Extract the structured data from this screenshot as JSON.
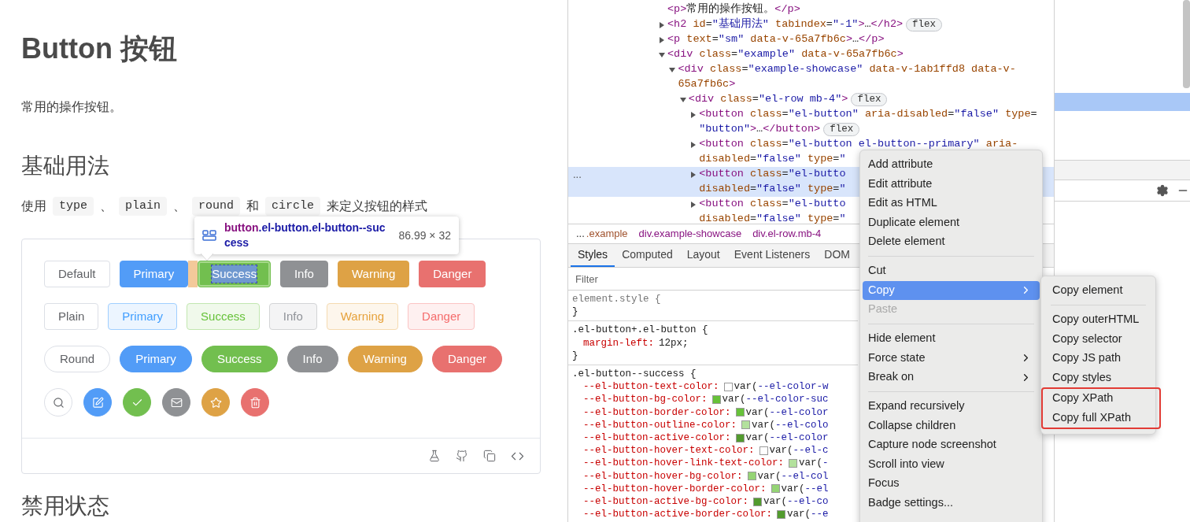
{
  "page": {
    "title": "Button 按钮",
    "intro": "常用的操作按钮。",
    "section_title": "基础用法",
    "usage": [
      {
        "kind": "text",
        "text": "使用"
      },
      {
        "kind": "code",
        "text": "type"
      },
      {
        "kind": "text",
        "text": "、"
      },
      {
        "kind": "code",
        "text": "plain"
      },
      {
        "kind": "text",
        "text": "、"
      },
      {
        "kind": "code",
        "text": "round"
      },
      {
        "kind": "text",
        "text": "和"
      },
      {
        "kind": "code",
        "text": "circle"
      },
      {
        "kind": "text",
        "text": "来定义按钮的样式"
      }
    ],
    "button_rows": [
      {
        "kind": "solid",
        "buttons": [
          {
            "kind": "default",
            "label": "Default",
            "inspected": false
          },
          {
            "kind": "primary",
            "label": "Primary",
            "inspected": false
          },
          {
            "kind": "success",
            "label": "Success",
            "inspected": true
          },
          {
            "kind": "info",
            "label": "Info",
            "inspected": false
          },
          {
            "kind": "warning",
            "label": "Warning",
            "inspected": false
          },
          {
            "kind": "danger",
            "label": "Danger",
            "inspected": false
          }
        ]
      },
      {
        "kind": "plain",
        "buttons": [
          {
            "kind": "default",
            "label": "Plain",
            "inspected": false
          },
          {
            "kind": "primary",
            "label": "Primary",
            "inspected": false
          },
          {
            "kind": "success",
            "label": "Success",
            "inspected": false
          },
          {
            "kind": "info",
            "label": "Info",
            "inspected": false
          },
          {
            "kind": "warning",
            "label": "Warning",
            "inspected": false
          },
          {
            "kind": "danger",
            "label": "Danger",
            "inspected": false
          }
        ]
      },
      {
        "kind": "round",
        "buttons": [
          {
            "kind": "default",
            "label": "Round",
            "inspected": false
          },
          {
            "kind": "primary",
            "label": "Primary",
            "inspected": false
          },
          {
            "kind": "success",
            "label": "Success",
            "inspected": false
          },
          {
            "kind": "info",
            "label": "Info",
            "inspected": false
          },
          {
            "kind": "warning",
            "label": "Warning",
            "inspected": false
          },
          {
            "kind": "danger",
            "label": "Danger",
            "inspected": false
          }
        ]
      },
      {
        "kind": "circle",
        "buttons": [
          {
            "kind": "default",
            "inspected": false
          },
          {
            "kind": "primary",
            "inspected": false
          },
          {
            "kind": "success",
            "inspected": false
          },
          {
            "kind": "info",
            "inspected": false
          },
          {
            "kind": "warning",
            "inspected": false
          },
          {
            "kind": "danger",
            "inspected": false
          }
        ]
      }
    ],
    "next_section_title": "禁用状态",
    "inspect_tooltip": {
      "tag": "button",
      "classes": ".el-button.el-button--success",
      "size": "86.99 × 32"
    }
  },
  "elements_tree": [
    {
      "kind": "leaf",
      "lines": [
        "<p>常用的操作按钮。</p>"
      ],
      "selected": false
    },
    {
      "kind": "node",
      "expanded": false,
      "lines": [
        "<h2 id=\"基础用法\" tabindex=\"-1\">…</h2>"
      ],
      "badge": "flex",
      "selected": false
    },
    {
      "kind": "node",
      "expanded": false,
      "lines": [
        "<p text=\"sm\" data-v-65a7fb6c>…</p>"
      ],
      "selected": false
    },
    {
      "kind": "node",
      "expanded": true,
      "lines": [
        "<div class=\"example\" data-v-65a7fb6c>"
      ],
      "selected": false,
      "children": [
        {
          "kind": "node",
          "expanded": true,
          "lines": [
            "<div class=\"example-showcase\" data-v-1ab1ffd8 data-v-",
            "65a7fb6c>"
          ],
          "selected": false,
          "children": [
            {
              "kind": "node",
              "expanded": true,
              "lines": [
                "<div class=\"el-row mb-4\">"
              ],
              "badge": "flex",
              "selected": false,
              "children": [
                {
                  "kind": "node",
                  "expanded": false,
                  "lines": [
                    "<button class=\"el-button\" aria-disabled=\"false\" type=",
                    "\"button\">…</button>"
                  ],
                  "badge": "flex",
                  "selected": false
                },
                {
                  "kind": "node",
                  "expanded": false,
                  "lines": [
                    "<button class=\"el-button el-button--primary\" aria-",
                    "disabled=\"false\" type=\""
                  ],
                  "selected": false
                },
                {
                  "kind": "node",
                  "expanded": false,
                  "lines": [
                    "<button class=\"el-butto",
                    "disabled=\"false\" type=\""
                  ],
                  "selected": true,
                  "gutter": "..."
                },
                {
                  "kind": "node",
                  "expanded": false,
                  "lines": [
                    "<button class=\"el-butto",
                    "disabled=\"false\" type=\""
                  ],
                  "selected": false
                }
              ]
            }
          ]
        }
      ]
    }
  ],
  "breadcrumbs": {
    "more": "...",
    "items": [
      {
        "text": ".example",
        "color": "#a0522d"
      },
      {
        "text": "div.example-showcase",
        "color": "#881280"
      },
      {
        "text": "div.el-row.mb-4",
        "color": "#881280"
      }
    ]
  },
  "sidebar_tabs": [
    {
      "label": "Styles",
      "selected": true
    },
    {
      "label": "Computed",
      "selected": false
    },
    {
      "label": "Layout",
      "selected": false
    },
    {
      "label": "Event Listeners",
      "selected": false
    },
    {
      "label": "DOM",
      "selected": false
    }
  ],
  "filter": {
    "placeholder": "Filter"
  },
  "css_rules": [
    {
      "selector": "element.style {",
      "inline": true,
      "close": "}"
    },
    {
      "selector": ".el-button+.el-button {",
      "inline": false,
      "declarations": [
        {
          "prop": "margin-left:",
          "value": "12px;"
        }
      ],
      "close": "}"
    },
    {
      "selector": ".el-button--success {",
      "inline": false,
      "declarations": [
        {
          "prop": "--el-button-text-color:",
          "color": "#ffffff",
          "value": "var(--el-color-w"
        },
        {
          "prop": "--el-button-bg-color:",
          "color": "#67c23a",
          "value": "var(--el-color-suc"
        },
        {
          "prop": "--el-button-border-color:",
          "color": "#67c23a",
          "value": "var(--el-color"
        },
        {
          "prop": "--el-button-outline-color:",
          "color": "#b3e19d",
          "value": "var(--el-colo"
        },
        {
          "prop": "--el-button-active-color:",
          "color": "#529b2e",
          "value": "var(--el-color"
        },
        {
          "prop": "--el-button-hover-text-color:",
          "color": "#ffffff",
          "value": "var(--el-c"
        },
        {
          "prop": "--el-button-hover-link-text-color:",
          "color": "#b3e19d",
          "value": "var(-"
        },
        {
          "prop": "--el-button-hover-bg-color:",
          "color": "#95d475",
          "value": "var(--el-col"
        },
        {
          "prop": "--el-button-hover-border-color:",
          "color": "#95d475",
          "value": "var(--el"
        },
        {
          "prop": "--el-button-active-bg-color:",
          "color": "#529b2e",
          "value": "var(--el-co"
        },
        {
          "prop": "--el-button-active-border-color:",
          "color": "#529b2e",
          "value": "var(--e"
        }
      ]
    }
  ],
  "context_menu": {
    "groups": [
      [
        {
          "label": "Add attribute",
          "selected": false,
          "disabled": false,
          "has_submenu": false
        },
        {
          "label": "Edit attribute",
          "selected": false,
          "disabled": false,
          "has_submenu": false
        },
        {
          "label": "Edit as HTML",
          "selected": false,
          "disabled": false,
          "has_submenu": false
        },
        {
          "label": "Duplicate element",
          "selected": false,
          "disabled": false,
          "has_submenu": false
        },
        {
          "label": "Delete element",
          "selected": false,
          "disabled": false,
          "has_submenu": false
        }
      ],
      [
        {
          "label": "Cut",
          "selected": false,
          "disabled": false,
          "has_submenu": false
        },
        {
          "label": "Copy",
          "selected": true,
          "disabled": false,
          "has_submenu": true
        },
        {
          "label": "Paste",
          "selected": false,
          "disabled": true,
          "has_submenu": false
        }
      ],
      [
        {
          "label": "Hide element",
          "selected": false,
          "disabled": false,
          "has_submenu": false
        },
        {
          "label": "Force state",
          "selected": false,
          "disabled": false,
          "has_submenu": true
        },
        {
          "label": "Break on",
          "selected": false,
          "disabled": false,
          "has_submenu": true
        }
      ],
      [
        {
          "label": "Expand recursively",
          "selected": false,
          "disabled": false,
          "has_submenu": false
        },
        {
          "label": "Collapse children",
          "selected": false,
          "disabled": false,
          "has_submenu": false
        },
        {
          "label": "Capture node screenshot",
          "selected": false,
          "disabled": false,
          "has_submenu": false
        },
        {
          "label": "Scroll into view",
          "selected": false,
          "disabled": false,
          "has_submenu": false
        },
        {
          "label": "Focus",
          "selected": false,
          "disabled": false,
          "has_submenu": false
        },
        {
          "label": "Badge settings...",
          "selected": false,
          "disabled": false,
          "has_submenu": false
        }
      ]
    ]
  },
  "submenu": {
    "groups": [
      [
        {
          "label": "Copy element",
          "highlighted": false
        }
      ],
      [
        {
          "label": "Copy outerHTML",
          "highlighted": false
        },
        {
          "label": "Copy selector",
          "highlighted": false
        },
        {
          "label": "Copy JS path",
          "highlighted": false
        },
        {
          "label": "Copy styles",
          "highlighted": false
        },
        {
          "label": "Copy XPath",
          "highlighted": true
        },
        {
          "label": "Copy full XPath",
          "highlighted": true
        }
      ]
    ]
  }
}
